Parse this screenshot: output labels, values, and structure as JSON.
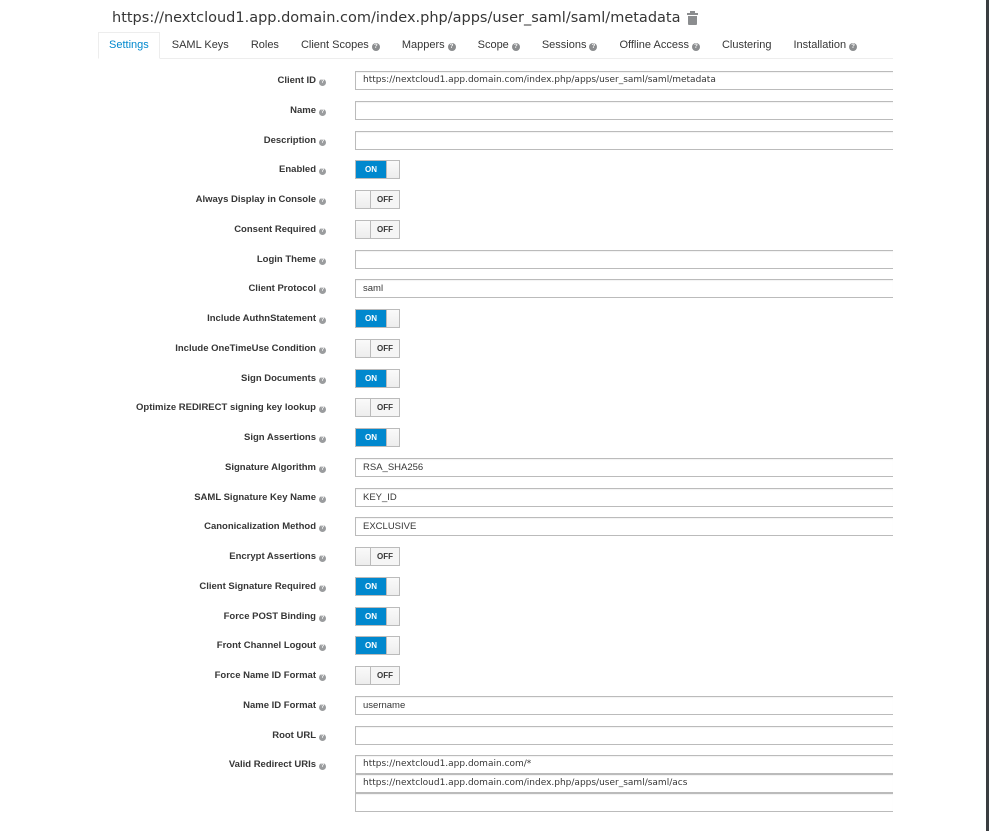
{
  "header": {
    "title": "https://nextcloud1.app.domain.com/index.php/apps/user_saml/saml/metadata",
    "delete_icon": "trash-icon"
  },
  "tabs": [
    {
      "label": "Settings",
      "help": false,
      "active": true
    },
    {
      "label": "SAML Keys",
      "help": false
    },
    {
      "label": "Roles",
      "help": false
    },
    {
      "label": "Client Scopes",
      "help": true
    },
    {
      "label": "Mappers",
      "help": true
    },
    {
      "label": "Scope",
      "help": true
    },
    {
      "label": "Sessions",
      "help": true
    },
    {
      "label": "Offline Access",
      "help": true
    },
    {
      "label": "Clustering",
      "help": false
    },
    {
      "label": "Installation",
      "help": true
    }
  ],
  "toggle_labels": {
    "on": "ON",
    "off": "OFF"
  },
  "help_glyph": "?",
  "form": {
    "client_id": {
      "label": "Client ID",
      "value": "https://nextcloud1.app.domain.com/index.php/apps/user_saml/saml/metadata"
    },
    "name": {
      "label": "Name",
      "value": ""
    },
    "description": {
      "label": "Description",
      "value": ""
    },
    "enabled": {
      "label": "Enabled",
      "value": true
    },
    "always_display": {
      "label": "Always Display in Console",
      "value": false
    },
    "consent_required": {
      "label": "Consent Required",
      "value": false
    },
    "login_theme": {
      "label": "Login Theme",
      "value": ""
    },
    "client_protocol": {
      "label": "Client Protocol",
      "value": "saml"
    },
    "include_authn": {
      "label": "Include AuthnStatement",
      "value": true
    },
    "include_onetimeuse": {
      "label": "Include OneTimeUse Condition",
      "value": false
    },
    "sign_documents": {
      "label": "Sign Documents",
      "value": true
    },
    "optimize_redirect": {
      "label": "Optimize REDIRECT signing key lookup",
      "value": false
    },
    "sign_assertions": {
      "label": "Sign Assertions",
      "value": true
    },
    "signature_algorithm": {
      "label": "Signature Algorithm",
      "value": "RSA_SHA256"
    },
    "saml_signature_key_name": {
      "label": "SAML Signature Key Name",
      "value": "KEY_ID"
    },
    "canonicalization_method": {
      "label": "Canonicalization Method",
      "value": "EXCLUSIVE"
    },
    "encrypt_assertions": {
      "label": "Encrypt Assertions",
      "value": false
    },
    "client_signature_required": {
      "label": "Client Signature Required",
      "value": true
    },
    "force_post_binding": {
      "label": "Force POST Binding",
      "value": true
    },
    "front_channel_logout": {
      "label": "Front Channel Logout",
      "value": true
    },
    "force_name_id_format": {
      "label": "Force Name ID Format",
      "value": false
    },
    "name_id_format": {
      "label": "Name ID Format",
      "value": "username"
    },
    "root_url": {
      "label": "Root URL",
      "value": ""
    },
    "valid_redirect_uris": {
      "label": "Valid Redirect URIs",
      "values": [
        "https://nextcloud1.app.domain.com/*",
        "https://nextcloud1.app.domain.com/index.php/apps/user_saml/saml/acs",
        ""
      ]
    }
  }
}
